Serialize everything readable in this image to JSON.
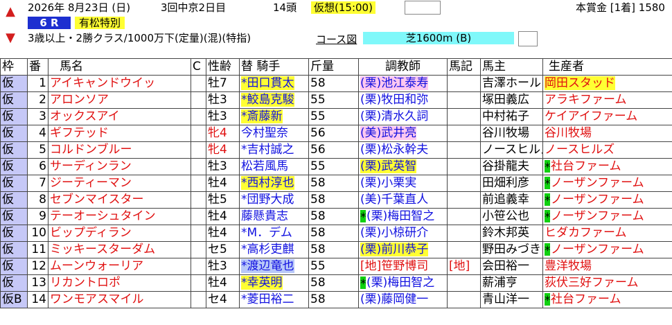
{
  "header": {
    "date": "2026年  8月23日 (日)",
    "meeting": "3回中京2日目",
    "runners": "14頭",
    "virtual": "仮想(15:00)",
    "prize": "本賞金 [1着] 1580",
    "race_no": "6 R",
    "race_name": "有松特別",
    "conditions": "3歳以上・2勝クラス/1000万下(定量)(混)(特指)",
    "course_label": "コース図",
    "course": "芝1600m (B)",
    "colors": {
      "badge": "#1d2fd0",
      "yellow": "#ffff33",
      "cyan": "#7ff8fa",
      "waku": "#c6c8f7",
      "arrow": "#d31e1e"
    }
  },
  "columns": {
    "waku": "枠",
    "ban": "番",
    "name": "馬名",
    "c": "C",
    "sex_age": "性齢",
    "jockey": "替 騎手",
    "weight": "斤量",
    "trainer": "調教師",
    "mark": "馬記",
    "owner": "馬主",
    "breeder": "生産者"
  },
  "rows": [
    {
      "waku": "仮",
      "ban": "1",
      "name": "アイキャンドウイッ",
      "sex": "牡7",
      "sexRed": false,
      "jocSwap": "*",
      "jockey": "田口貫太",
      "jocHl": "y",
      "weight": "58",
      "trMark": "",
      "trainer": "(栗)池江泰寿",
      "trHl": "p",
      "mark": "",
      "owner": "吉澤ホール",
      "brMark": "",
      "breeder": "岡田スタッド",
      "brHl": "y",
      "trRed": false,
      "brRed": true
    },
    {
      "waku": "仮",
      "ban": "2",
      "name": "アロンソア",
      "sex": "牡3",
      "sexRed": false,
      "jocSwap": "*",
      "jockey": "鮫島克駿",
      "jocHl": "y",
      "weight": "55",
      "trMark": "",
      "trainer": "(栗)牧田和弥",
      "trHl": "",
      "mark": "",
      "owner": "塚田義広",
      "brMark": "",
      "breeder": "アラキファーム",
      "brHl": "",
      "trRed": false,
      "brRed": true
    },
    {
      "waku": "仮",
      "ban": "3",
      "name": "オックスアイ",
      "sex": "牡3",
      "sexRed": false,
      "jocSwap": "*",
      "jockey": "斎藤新",
      "jocHl": "y",
      "weight": "55",
      "trMark": "",
      "trainer": "(栗)清水久詞",
      "trHl": "",
      "mark": "",
      "owner": "中村祐子",
      "brMark": "",
      "breeder": "ケイアイファーム",
      "brHl": "",
      "trRed": false,
      "brRed": true
    },
    {
      "waku": "仮",
      "ban": "4",
      "name": "ギフテッド",
      "sex": "牝4",
      "sexRed": true,
      "jocSwap": "",
      "jockey": "今村聖奈",
      "jocHl": "",
      "weight": "56",
      "trMark": "",
      "trainer": "(美)武井亮",
      "trHl": "p",
      "mark": "",
      "owner": "谷川牧場",
      "brMark": "",
      "breeder": "谷川牧場",
      "brHl": "",
      "trRed": false,
      "brRed": true
    },
    {
      "waku": "仮",
      "ban": "5",
      "name": "コルドンブルー",
      "sex": "牝4",
      "sexRed": true,
      "jocSwap": "*",
      "jockey": "吉村誠之",
      "jocHl": "",
      "weight": "56",
      "trMark": "",
      "trainer": "(栗)松永幹夫",
      "trHl": "",
      "mark": "",
      "owner": "ノースヒルズ",
      "brMark": "",
      "breeder": "ノースヒルズ",
      "brHl": "",
      "trRed": false,
      "brRed": true
    },
    {
      "waku": "仮",
      "ban": "6",
      "name": "サーディンラン",
      "sex": "牡3",
      "sexRed": false,
      "jocSwap": "",
      "jockey": "松若風馬",
      "jocHl": "",
      "weight": "55",
      "trMark": "",
      "trainer": "(栗)武英智",
      "trHl": "y",
      "mark": "",
      "owner": "谷掛龍夫",
      "brMark": "*",
      "breeder": "社台ファーム",
      "brHl": "",
      "trRed": false,
      "brRed": true
    },
    {
      "waku": "仮",
      "ban": "7",
      "name": "ジーティーマン",
      "sex": "牡4",
      "sexRed": false,
      "jocSwap": "*",
      "jockey": "西村淳也",
      "jocHl": "y",
      "weight": "58",
      "trMark": "",
      "trainer": "(栗)小栗実",
      "trHl": "",
      "mark": "",
      "owner": "田畑利彦",
      "brMark": "*",
      "breeder": "ノーザンファーム",
      "brHl": "",
      "trRed": false,
      "brRed": true
    },
    {
      "waku": "仮",
      "ban": "8",
      "name": "セブンマイスター",
      "sex": "牡5",
      "sexRed": false,
      "jocSwap": "*",
      "jockey": "団野大成",
      "jocHl": "",
      "weight": "58",
      "trMark": "",
      "trainer": "(美)千葉直人",
      "trHl": "",
      "mark": "",
      "owner": "前追義幸",
      "brMark": "*",
      "breeder": "ノーザンファーム",
      "brHl": "",
      "trRed": false,
      "brRed": true
    },
    {
      "waku": "仮",
      "ban": "9",
      "name": "テーオーシュタイン",
      "sex": "牡4",
      "sexRed": false,
      "jocSwap": "",
      "jockey": "藤懸貴志",
      "jocHl": "",
      "weight": "58",
      "trMark": "*",
      "trainer": "(栗)梅田智之",
      "trHl": "",
      "mark": "",
      "owner": "小笹公也",
      "brMark": "*",
      "breeder": "ノーザンファーム",
      "brHl": "",
      "trRed": false,
      "brRed": true
    },
    {
      "waku": "仮",
      "ban": "10",
      "name": "ビップディラン",
      "sex": "牡4",
      "sexRed": false,
      "jocSwap": "*",
      "jockey": "M．デム",
      "jocHl": "",
      "weight": "58",
      "trMark": "",
      "trainer": "(栗)小椋研介",
      "trHl": "",
      "mark": "",
      "owner": "鈴木邦英",
      "brMark": "",
      "breeder": "ヒダカファーム",
      "brHl": "",
      "trRed": false,
      "brRed": true
    },
    {
      "waku": "仮",
      "ban": "11",
      "name": "ミッキースターダム",
      "sex": "セ5",
      "sexRed": false,
      "jocSwap": "*",
      "jockey": "高杉吏麒",
      "jocHl": "",
      "weight": "58",
      "trMark": "",
      "trainer": "(栗)前川恭子",
      "trHl": "y",
      "mark": "",
      "owner": "野田みづき",
      "brMark": "*",
      "breeder": "ノーザンファーム",
      "brHl": "",
      "trRed": false,
      "brRed": true
    },
    {
      "waku": "仮",
      "ban": "12",
      "name": "ムーンウォーリア",
      "sex": "牡3",
      "sexRed": false,
      "jocSwap": "*",
      "jockey": "渡辺竜也",
      "jocHl": "b",
      "weight": "55",
      "trMark": "",
      "trainer": "[地]笹野博司",
      "trHl": "",
      "mark": "[地]",
      "owner": "会田裕一",
      "brMark": "",
      "breeder": "豊洋牧場",
      "brHl": "",
      "trRed": true,
      "brRed": true
    },
    {
      "waku": "仮",
      "ban": "13",
      "name": "リカントロポ",
      "sex": "牡4",
      "sexRed": false,
      "jocSwap": "*",
      "jockey": "幸英明",
      "jocHl": "y",
      "weight": "58",
      "trMark": "*",
      "trainer": "(栗)梅田智之",
      "trHl": "",
      "mark": "",
      "owner": "薪浦亨",
      "brMark": "",
      "breeder": "荻伏三好ファーム",
      "brHl": "",
      "trRed": false,
      "brRed": true
    },
    {
      "waku": "仮B",
      "ban": "14",
      "name": "ワンモアスマイル",
      "sex": "セ4",
      "sexRed": false,
      "jocSwap": "*",
      "jockey": "菱田裕二",
      "jocHl": "",
      "weight": "58",
      "trMark": "",
      "trainer": "(栗)藤岡健一",
      "trHl": "",
      "mark": "",
      "owner": "青山洋一",
      "brMark": "*",
      "breeder": "社台ファーム",
      "brHl": "",
      "trRed": false,
      "brRed": true
    }
  ]
}
